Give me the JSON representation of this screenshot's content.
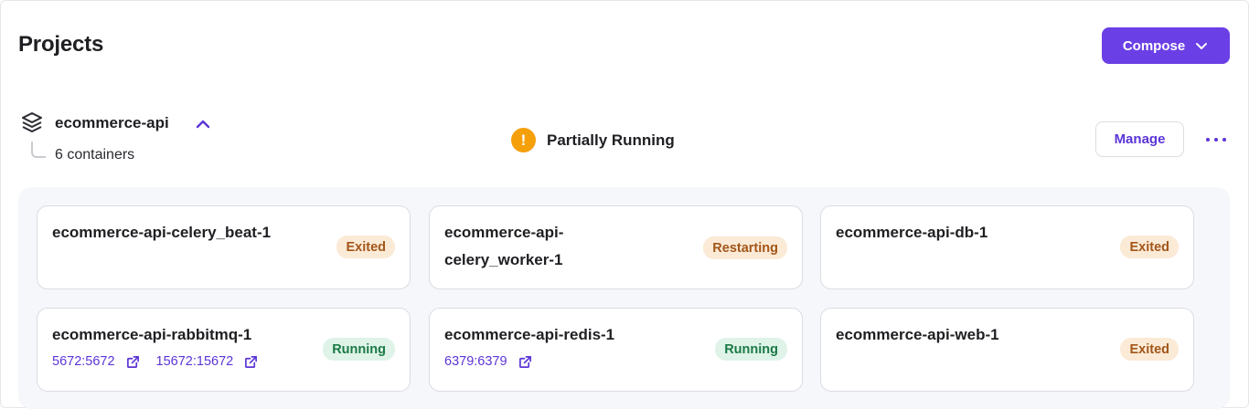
{
  "header": {
    "title": "Projects",
    "compose_label": "Compose"
  },
  "project": {
    "name": "ecommerce-api",
    "containers_label": "6 containers",
    "status": "Partially Running",
    "manage_label": "Manage",
    "status_icon_glyph": "!"
  },
  "containers": [
    {
      "name": "ecommerce-api-celery_beat-1",
      "status": "Exited",
      "ports": []
    },
    {
      "name": "ecommerce-api-celery_worker-1",
      "name_line1": "ecommerce-api-",
      "name_line2": "celery_worker-1",
      "status": "Restarting",
      "ports": []
    },
    {
      "name": "ecommerce-api-db-1",
      "status": "Exited",
      "ports": []
    },
    {
      "name": "ecommerce-api-rabbitmq-1",
      "status": "Running",
      "ports": [
        "5672:5672",
        "15672:15672"
      ]
    },
    {
      "name": "ecommerce-api-redis-1",
      "status": "Running",
      "ports": [
        "6379:6379"
      ]
    },
    {
      "name": "ecommerce-api-web-1",
      "status": "Exited",
      "ports": []
    }
  ],
  "colors": {
    "accent": "#6b3fe6",
    "link": "#5b34d6",
    "warning": "#f59f0a",
    "exited_bg": "#fbead6",
    "exited_text": "#a2561a",
    "running_bg": "#dff3e8",
    "running_text": "#1a7a45"
  },
  "icons": {
    "compose": "chevron-down-icon",
    "project": "layers-icon",
    "collapse": "chevron-up-icon",
    "status": "warning-icon",
    "more": "more-horizontal-icon",
    "port": "external-link-icon"
  }
}
